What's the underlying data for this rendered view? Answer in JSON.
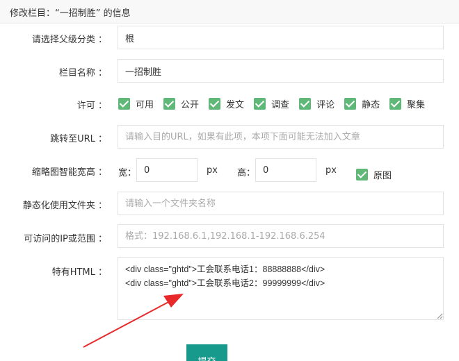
{
  "dialog": {
    "title": "修改栏目：“一招制胜” 的信息"
  },
  "form": {
    "parent_category": {
      "label": "请选择父级分类 ：",
      "value": "根"
    },
    "column_name": {
      "label": "栏目名称 ：",
      "value": "一招制胜"
    },
    "permissions": {
      "label": "许可 ：",
      "items": [
        {
          "label": "可用",
          "checked": true
        },
        {
          "label": "公开",
          "checked": true
        },
        {
          "label": "发文",
          "checked": true
        },
        {
          "label": "调查",
          "checked": true
        },
        {
          "label": "评论",
          "checked": true
        },
        {
          "label": "静态",
          "checked": true
        },
        {
          "label": "聚集",
          "checked": true
        }
      ]
    },
    "redirect_url": {
      "label": "跳转至URL ：",
      "placeholder": "请输入目的URL，如果有此项，本项下面可能无法加入文章"
    },
    "thumbnail": {
      "label": "缩略图智能宽高 ：",
      "width_label": "宽：",
      "width_value": "0",
      "width_unit": "px",
      "height_label": "高：",
      "height_value": "0",
      "height_unit": "px",
      "original_label": "原图",
      "original_checked": true
    },
    "static_folder": {
      "label": "静态化使用文件夹 ：",
      "placeholder": "请输入一个文件夹名称"
    },
    "ip_range": {
      "label": "可访问的IP或范围 ：",
      "placeholder": "格式：192.168.6.1,192.168.1-192.168.6.254"
    },
    "special_html": {
      "label": "特有HTML ：",
      "lines": [
        "<div class=\"ghtd\">工会联系电话1：88888888</div>",
        "<div class=\"ghtd\">工会联系电话2：99999999</div>"
      ]
    },
    "submit_label": "提交"
  },
  "colors": {
    "accent_checkbox": "#5fb878",
    "submit_button": "#17998c",
    "annotation_arrow": "#e8292a"
  }
}
